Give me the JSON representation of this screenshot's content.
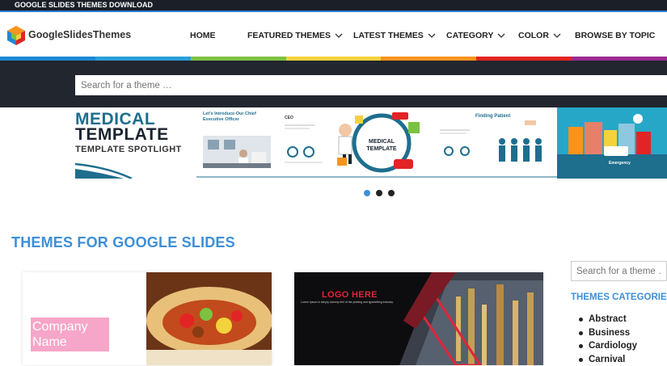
{
  "topbar": {
    "label": "GOOGLE SLIDES THEMES DOWNLOAD"
  },
  "header": {
    "brand": "GoogleSlidesThemes",
    "nav": [
      {
        "label": "HOME",
        "has_dropdown": false
      },
      {
        "label": "FEATURED THEMES",
        "has_dropdown": true
      },
      {
        "label": "LATEST THEMES",
        "has_dropdown": true
      },
      {
        "label": "CATEGORY",
        "has_dropdown": true
      },
      {
        "label": "COLOR",
        "has_dropdown": true
      },
      {
        "label": "BROWSE BY TOPIC",
        "has_dropdown": false
      }
    ],
    "stripe_colors": [
      "#1e88d4",
      "#2a9fd8",
      "#7cc242",
      "#f4d23c",
      "#f7941d",
      "#e32424",
      "#9b2a8f"
    ]
  },
  "search": {
    "placeholder": "Search for a theme …"
  },
  "banner": {
    "title_line1": "MEDICAL",
    "title_line2": "TEMPLATE",
    "subtitle": "TEMPLATE SPOTLIGHT",
    "slide1_title": "Let's Introduce Our Chief Executive Officer",
    "slide2_label": "CEO",
    "slide3_label": "MEDICAL TEMPLATE",
    "slide4_label": "Finding Patient",
    "slide5_label": "Emergency",
    "dots": [
      {
        "active": true
      },
      {
        "active": false
      },
      {
        "active": false
      }
    ]
  },
  "main": {
    "section_title": "THEMES FOR GOOGLE SLIDES",
    "cards": [
      {
        "label": "Company Name"
      },
      {
        "label": "LOGO HERE",
        "text": "Lorem Ipsum is simply dummy text of the printing and typesetting industry."
      }
    ]
  },
  "sidebar": {
    "search_placeholder": "Search for a theme …",
    "heading": "THEMES CATEGORIES",
    "categories": [
      "Abstract",
      "Business",
      "Cardiology",
      "Carnival"
    ]
  },
  "colors": {
    "accent": "#3e8fd6",
    "dark": "#22262e",
    "topbar": "#1b1f27"
  }
}
